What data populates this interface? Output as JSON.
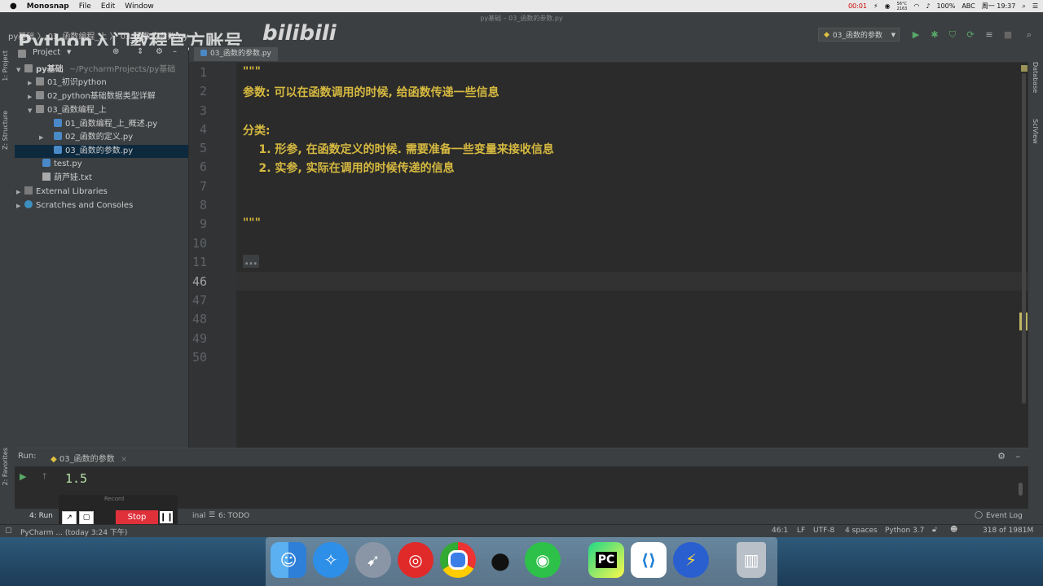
{
  "menubar": {
    "apple": "",
    "app": "Monosnap",
    "items": [
      "File",
      "Edit",
      "Window"
    ],
    "timer": "00:01",
    "temp_top": "56°C",
    "temp_bottom": "2163",
    "battery": "100%",
    "input": "ABC",
    "clock": "周一 19:37"
  },
  "window": {
    "title": "py基础 – 03_函数的参数.py"
  },
  "nav": {
    "breadcrumb": "py基础  〉 03_函数编程_上  〉 03_函数的参数.py",
    "watermark": "Python入门教程官方账号",
    "bilibili": "bilibili",
    "run_config": "03_函数的参数"
  },
  "left_tabs": {
    "project": "1: Project",
    "structure": "Z: Structure",
    "favorites": "2: Favorites"
  },
  "right_tabs": {
    "database": "Database",
    "sciview": "SciView"
  },
  "project": {
    "header": "Project",
    "root_name": "py基础",
    "root_path": "~/PycharmProjects/py基础",
    "items": [
      {
        "label": "01_初识python"
      },
      {
        "label": "02_python基础数据类型详解"
      },
      {
        "label": "03_函数编程_上"
      },
      {
        "label": "01_函数编程_上_概述.py"
      },
      {
        "label": "02_函数的定义.py"
      },
      {
        "label": "03_函数的参数.py"
      },
      {
        "label": "test.py"
      },
      {
        "label": "葫芦娃.txt"
      },
      {
        "label": "External Libraries"
      },
      {
        "label": "Scratches and Consoles"
      }
    ]
  },
  "editor": {
    "tab": "03_函数的参数.py",
    "line_numbers": [
      "1",
      "2",
      "3",
      "4",
      "5",
      "6",
      "7",
      "8",
      "9",
      "10",
      "11",
      "46",
      "47",
      "48",
      "49",
      "50"
    ],
    "lines": [
      "\"\"\"",
      "参数: 可以在函数调用的时候, 给函数传递一些信息",
      "",
      "分类:",
      "    1. 形参, 在函数定义的时候. 需要准备一些变量来接收信息",
      "    2. 实参, 实际在调用的时候传递的信息",
      "",
      "",
      "\"\"\"",
      "",
      "..."
    ]
  },
  "run": {
    "label": "Run:",
    "tab": "03_函数的参数",
    "output": "1.5"
  },
  "record": {
    "title": "Record",
    "stop": "Stop"
  },
  "bottom_tabs": {
    "run": "4: Run",
    "terminal": "inal",
    "todo": "6: TODO",
    "event_log": "Event Log"
  },
  "status": {
    "message": "PyCharm ... (today 3:24 下午)",
    "position": "46:1",
    "line_sep": "LF",
    "encoding": "UTF-8",
    "indent": "4 spaces",
    "interpreter": "Python 3.7",
    "memory": "318 of 1981M"
  },
  "dock": {
    "apps": [
      "finder-icon",
      "safari-icon",
      "launchpad-icon",
      "netease-music-icon",
      "chrome-icon",
      "qq-icon",
      "wechat-icon",
      "pycharm-icon",
      "vscode-icon",
      "thunder-icon",
      "trash-icon"
    ],
    "pycharm_text": "PC"
  }
}
